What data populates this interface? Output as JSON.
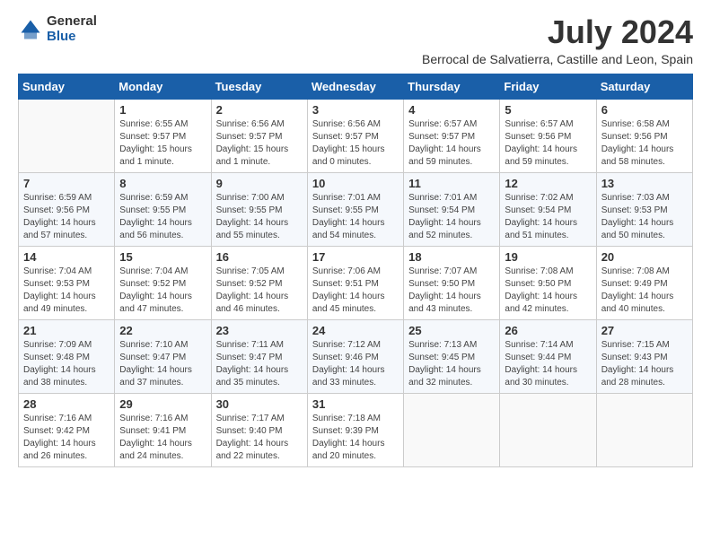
{
  "logo": {
    "general": "General",
    "blue": "Blue"
  },
  "title": "July 2024",
  "location": "Berrocal de Salvatierra, Castille and Leon, Spain",
  "days_of_week": [
    "Sunday",
    "Monday",
    "Tuesday",
    "Wednesday",
    "Thursday",
    "Friday",
    "Saturday"
  ],
  "weeks": [
    [
      {
        "day": "",
        "sunrise": "",
        "sunset": "",
        "daylight": ""
      },
      {
        "day": "1",
        "sunrise": "Sunrise: 6:55 AM",
        "sunset": "Sunset: 9:57 PM",
        "daylight": "Daylight: 15 hours and 1 minute."
      },
      {
        "day": "2",
        "sunrise": "Sunrise: 6:56 AM",
        "sunset": "Sunset: 9:57 PM",
        "daylight": "Daylight: 15 hours and 1 minute."
      },
      {
        "day": "3",
        "sunrise": "Sunrise: 6:56 AM",
        "sunset": "Sunset: 9:57 PM",
        "daylight": "Daylight: 15 hours and 0 minutes."
      },
      {
        "day": "4",
        "sunrise": "Sunrise: 6:57 AM",
        "sunset": "Sunset: 9:57 PM",
        "daylight": "Daylight: 14 hours and 59 minutes."
      },
      {
        "day": "5",
        "sunrise": "Sunrise: 6:57 AM",
        "sunset": "Sunset: 9:56 PM",
        "daylight": "Daylight: 14 hours and 59 minutes."
      },
      {
        "day": "6",
        "sunrise": "Sunrise: 6:58 AM",
        "sunset": "Sunset: 9:56 PM",
        "daylight": "Daylight: 14 hours and 58 minutes."
      }
    ],
    [
      {
        "day": "7",
        "sunrise": "Sunrise: 6:59 AM",
        "sunset": "Sunset: 9:56 PM",
        "daylight": "Daylight: 14 hours and 57 minutes."
      },
      {
        "day": "8",
        "sunrise": "Sunrise: 6:59 AM",
        "sunset": "Sunset: 9:55 PM",
        "daylight": "Daylight: 14 hours and 56 minutes."
      },
      {
        "day": "9",
        "sunrise": "Sunrise: 7:00 AM",
        "sunset": "Sunset: 9:55 PM",
        "daylight": "Daylight: 14 hours and 55 minutes."
      },
      {
        "day": "10",
        "sunrise": "Sunrise: 7:01 AM",
        "sunset": "Sunset: 9:55 PM",
        "daylight": "Daylight: 14 hours and 54 minutes."
      },
      {
        "day": "11",
        "sunrise": "Sunrise: 7:01 AM",
        "sunset": "Sunset: 9:54 PM",
        "daylight": "Daylight: 14 hours and 52 minutes."
      },
      {
        "day": "12",
        "sunrise": "Sunrise: 7:02 AM",
        "sunset": "Sunset: 9:54 PM",
        "daylight": "Daylight: 14 hours and 51 minutes."
      },
      {
        "day": "13",
        "sunrise": "Sunrise: 7:03 AM",
        "sunset": "Sunset: 9:53 PM",
        "daylight": "Daylight: 14 hours and 50 minutes."
      }
    ],
    [
      {
        "day": "14",
        "sunrise": "Sunrise: 7:04 AM",
        "sunset": "Sunset: 9:53 PM",
        "daylight": "Daylight: 14 hours and 49 minutes."
      },
      {
        "day": "15",
        "sunrise": "Sunrise: 7:04 AM",
        "sunset": "Sunset: 9:52 PM",
        "daylight": "Daylight: 14 hours and 47 minutes."
      },
      {
        "day": "16",
        "sunrise": "Sunrise: 7:05 AM",
        "sunset": "Sunset: 9:52 PM",
        "daylight": "Daylight: 14 hours and 46 minutes."
      },
      {
        "day": "17",
        "sunrise": "Sunrise: 7:06 AM",
        "sunset": "Sunset: 9:51 PM",
        "daylight": "Daylight: 14 hours and 45 minutes."
      },
      {
        "day": "18",
        "sunrise": "Sunrise: 7:07 AM",
        "sunset": "Sunset: 9:50 PM",
        "daylight": "Daylight: 14 hours and 43 minutes."
      },
      {
        "day": "19",
        "sunrise": "Sunrise: 7:08 AM",
        "sunset": "Sunset: 9:50 PM",
        "daylight": "Daylight: 14 hours and 42 minutes."
      },
      {
        "day": "20",
        "sunrise": "Sunrise: 7:08 AM",
        "sunset": "Sunset: 9:49 PM",
        "daylight": "Daylight: 14 hours and 40 minutes."
      }
    ],
    [
      {
        "day": "21",
        "sunrise": "Sunrise: 7:09 AM",
        "sunset": "Sunset: 9:48 PM",
        "daylight": "Daylight: 14 hours and 38 minutes."
      },
      {
        "day": "22",
        "sunrise": "Sunrise: 7:10 AM",
        "sunset": "Sunset: 9:47 PM",
        "daylight": "Daylight: 14 hours and 37 minutes."
      },
      {
        "day": "23",
        "sunrise": "Sunrise: 7:11 AM",
        "sunset": "Sunset: 9:47 PM",
        "daylight": "Daylight: 14 hours and 35 minutes."
      },
      {
        "day": "24",
        "sunrise": "Sunrise: 7:12 AM",
        "sunset": "Sunset: 9:46 PM",
        "daylight": "Daylight: 14 hours and 33 minutes."
      },
      {
        "day": "25",
        "sunrise": "Sunrise: 7:13 AM",
        "sunset": "Sunset: 9:45 PM",
        "daylight": "Daylight: 14 hours and 32 minutes."
      },
      {
        "day": "26",
        "sunrise": "Sunrise: 7:14 AM",
        "sunset": "Sunset: 9:44 PM",
        "daylight": "Daylight: 14 hours and 30 minutes."
      },
      {
        "day": "27",
        "sunrise": "Sunrise: 7:15 AM",
        "sunset": "Sunset: 9:43 PM",
        "daylight": "Daylight: 14 hours and 28 minutes."
      }
    ],
    [
      {
        "day": "28",
        "sunrise": "Sunrise: 7:16 AM",
        "sunset": "Sunset: 9:42 PM",
        "daylight": "Daylight: 14 hours and 26 minutes."
      },
      {
        "day": "29",
        "sunrise": "Sunrise: 7:16 AM",
        "sunset": "Sunset: 9:41 PM",
        "daylight": "Daylight: 14 hours and 24 minutes."
      },
      {
        "day": "30",
        "sunrise": "Sunrise: 7:17 AM",
        "sunset": "Sunset: 9:40 PM",
        "daylight": "Daylight: 14 hours and 22 minutes."
      },
      {
        "day": "31",
        "sunrise": "Sunrise: 7:18 AM",
        "sunset": "Sunset: 9:39 PM",
        "daylight": "Daylight: 14 hours and 20 minutes."
      },
      {
        "day": "",
        "sunrise": "",
        "sunset": "",
        "daylight": ""
      },
      {
        "day": "",
        "sunrise": "",
        "sunset": "",
        "daylight": ""
      },
      {
        "day": "",
        "sunrise": "",
        "sunset": "",
        "daylight": ""
      }
    ]
  ]
}
